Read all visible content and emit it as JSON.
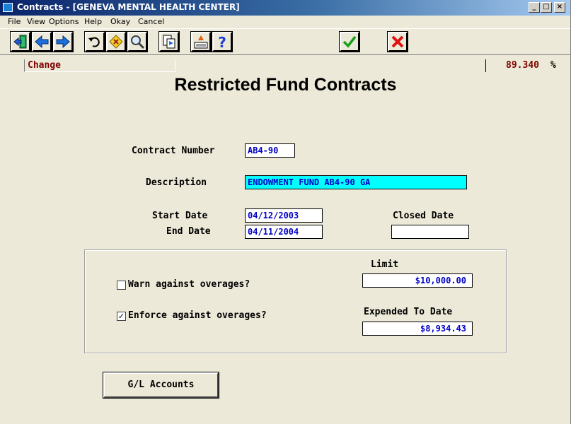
{
  "window": {
    "title": "Contracts - [GENEVA MENTAL HEALTH CENTER]",
    "minimize": "_",
    "maximize": "□",
    "close": "×"
  },
  "menu": [
    {
      "label": "File"
    },
    {
      "label": "View"
    },
    {
      "label": "Options"
    },
    {
      "label": "Help"
    },
    {
      "label": "Okay"
    },
    {
      "label": "Cancel"
    }
  ],
  "toolbar": {
    "buttons": [
      "exit-icon",
      "back-arrow-icon",
      "forward-arrow-icon",
      "undo-icon",
      "tools-icon",
      "magnifier-icon",
      "copy-doc-icon",
      "report-icon",
      "help-question-icon",
      "okay-check-icon",
      "cancel-x-icon"
    ]
  },
  "status": {
    "mode": "Change",
    "percent": "89.340",
    "percent_sign": "%"
  },
  "form": {
    "title": "Restricted Fund Contracts",
    "contract_number_label": "Contract Number",
    "contract_number": "AB4-90",
    "description_label": "Description",
    "description": "ENDOWMENT FUND AB4-90 GA",
    "start_date_label": "Start Date",
    "start_date": "04/12/2003",
    "end_date_label": "End Date",
    "end_date": "04/11/2004",
    "closed_date_label": "Closed Date",
    "closed_date": ""
  },
  "overages": {
    "warn_label": "Warn against overages?",
    "warn_checked": false,
    "enforce_label": "Enforce against overages?",
    "enforce_checked": true,
    "check_mark": "✓",
    "limit_label": "Limit",
    "limit": "$10,000.00",
    "expended_label": "Expended To Date",
    "expended": "$8,934.43"
  },
  "gl_button": {
    "label": "G/L Accounts"
  },
  "colors": {
    "title_bar": "#0a246a",
    "field_text": "#0000c8",
    "status_text": "#800000",
    "highlight_field": "#00ffff",
    "background": "#ece9d8"
  }
}
